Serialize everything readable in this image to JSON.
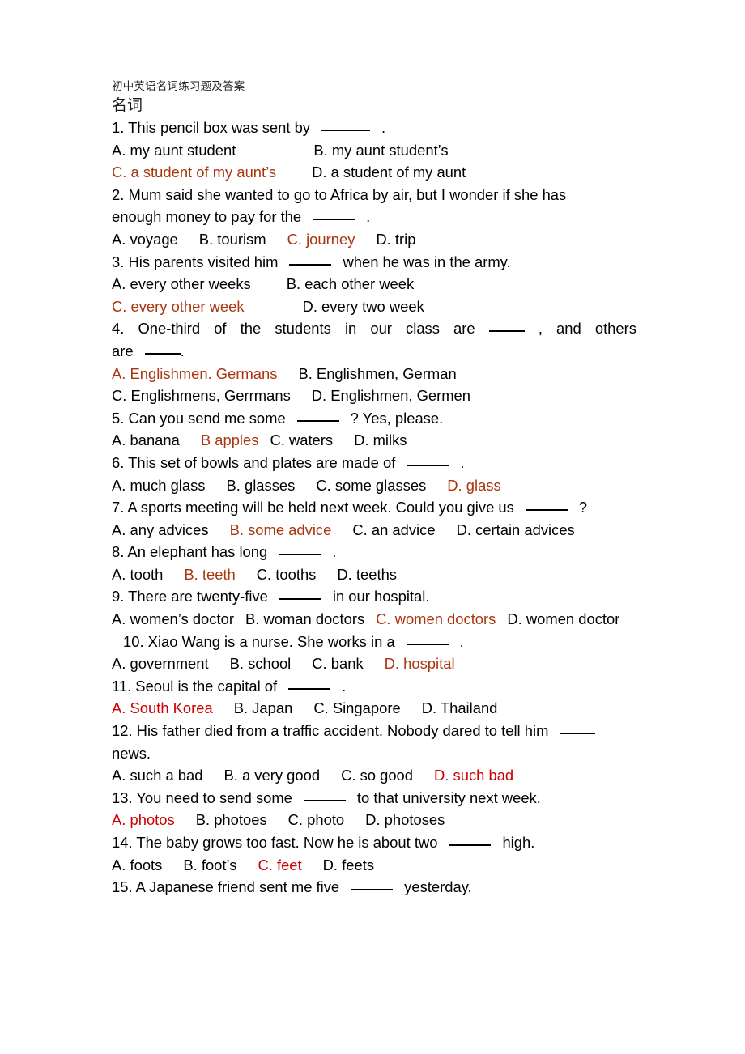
{
  "document": {
    "header_title": "初中英语名词练习题及答案",
    "subtitle": "名词",
    "colors": {
      "answer_brown": "#a8360f",
      "answer_red": "#cc0000",
      "body_text": "#000000",
      "background": "#ffffff"
    }
  },
  "questions": [
    {
      "number": "1",
      "stem_before": "1. This pencil box was sent by",
      "stem_after": ".",
      "options": [
        {
          "label": "A. my aunt student",
          "highlight": "none"
        },
        {
          "label": "B. my aunt student’s",
          "highlight": "none"
        },
        {
          "label": "C. a student of my aunt’s",
          "highlight": "brown"
        },
        {
          "label": "D. a student of my aunt",
          "highlight": "none"
        }
      ]
    },
    {
      "number": "2",
      "stem_line1": "2. Mum said she wanted to go to Africa by air, but    I wonder if she has",
      "stem_line2_before": "enough money to pay for the",
      "stem_line2_after": ".",
      "options": [
        {
          "label": "A. voyage",
          "highlight": "none"
        },
        {
          "label": "B. tourism",
          "highlight": "none"
        },
        {
          "label": "C. journey",
          "highlight": "brown"
        },
        {
          "label": "D. trip",
          "highlight": "none"
        }
      ]
    },
    {
      "number": "3",
      "stem_before": "3. His parents visited him",
      "stem_after": "when he was in the army.",
      "options": [
        {
          "label": "A. every other weeks",
          "highlight": "none"
        },
        {
          "label": "B. each other week",
          "highlight": "none"
        },
        {
          "label": "C. every other week",
          "highlight": "brown"
        },
        {
          "label": "D. every two week",
          "highlight": "none"
        }
      ]
    },
    {
      "number": "4",
      "stem_line1_before": "4. One-third of the students in our class are",
      "stem_line1_after": ", and others",
      "stem_line2_before": "are",
      "stem_line2_after": ".",
      "options": [
        {
          "label": "A. Englishmen. Germans",
          "highlight": "brown"
        },
        {
          "label": "B. Englishmen, German",
          "highlight": "none"
        },
        {
          "label": "C. Englishmens, Gerrmans",
          "highlight": "none"
        },
        {
          "label": "D. Englishmen, Germen",
          "highlight": "none"
        }
      ]
    },
    {
      "number": "5",
      "stem_before": "5. Can you send me some",
      "stem_after": "? Yes, please.",
      "options": [
        {
          "label": "A. banana",
          "highlight": "none"
        },
        {
          "label": "B apples",
          "highlight": "brown"
        },
        {
          "label": "C. waters",
          "highlight": "none"
        },
        {
          "label": "D. milks",
          "highlight": "none"
        }
      ]
    },
    {
      "number": "6",
      "stem_before": "6. This set of bowls and plates are made of",
      "stem_after": ".",
      "options": [
        {
          "label": "A. much glass",
          "highlight": "none"
        },
        {
          "label": "B. glasses",
          "highlight": "none"
        },
        {
          "label": "C. some glasses",
          "highlight": "none"
        },
        {
          "label": "D. glass",
          "highlight": "brown"
        }
      ]
    },
    {
      "number": "7",
      "stem_before": "7. A sports meeting will be held next week. Could you give us",
      "stem_after": "?",
      "options": [
        {
          "label": "A. any advices",
          "highlight": "none"
        },
        {
          "label": "B. some advice",
          "highlight": "brown"
        },
        {
          "label": "C. an advice",
          "highlight": "none"
        },
        {
          "label": "D. certain advices",
          "highlight": "none"
        }
      ]
    },
    {
      "number": "8",
      "stem_before": "8. An elephant has long",
      "stem_after": ".",
      "options": [
        {
          "label": "A. tooth",
          "highlight": "none"
        },
        {
          "label": "B. teeth",
          "highlight": "brown"
        },
        {
          "label": "C. tooths",
          "highlight": "none"
        },
        {
          "label": "D. teeths",
          "highlight": "none"
        }
      ]
    },
    {
      "number": "9",
      "stem_before": "9. There are twenty-five",
      "stem_after": "in our hospital.",
      "options": [
        {
          "label": "A. women’s doctor",
          "highlight": "none"
        },
        {
          "label": "B. woman doctors",
          "highlight": "none"
        },
        {
          "label": "C. women doctors",
          "highlight": "brown"
        },
        {
          "label": "D. women doctor",
          "highlight": "none"
        }
      ]
    },
    {
      "number": "10",
      "stem_before": "10. Xiao Wang is a nurse. She works in a",
      "stem_after": ".",
      "options": [
        {
          "label": "A. government",
          "highlight": "none"
        },
        {
          "label": "B. school",
          "highlight": "none"
        },
        {
          "label": "C. bank",
          "highlight": "none"
        },
        {
          "label": "D. hospital",
          "highlight": "brown"
        }
      ]
    },
    {
      "number": "11",
      "stem_before": "11. Seoul is the capital of",
      "stem_after": ".",
      "options": [
        {
          "label": "A. South Korea",
          "highlight": "red"
        },
        {
          "label": "B. Japan",
          "highlight": "none"
        },
        {
          "label": "C. Singapore",
          "highlight": "none"
        },
        {
          "label": "D. Thailand",
          "highlight": "none"
        }
      ]
    },
    {
      "number": "12",
      "stem_line1": "12. His father died from a traffic accident. Nobody dared to tell him",
      "stem_line2": "news.",
      "options": [
        {
          "label": "A. such a bad",
          "highlight": "none"
        },
        {
          "label": "B. a very good",
          "highlight": "none"
        },
        {
          "label": "C. so good",
          "highlight": "none"
        },
        {
          "label": "D. such bad",
          "highlight": "red"
        }
      ]
    },
    {
      "number": "13",
      "stem_before": "13. You need to send some",
      "stem_after": "to that university next week.",
      "options": [
        {
          "label": "A. photos",
          "highlight": "red"
        },
        {
          "label": "B. photoes",
          "highlight": "none"
        },
        {
          "label": "C. photo",
          "highlight": "none"
        },
        {
          "label": "D. photoses",
          "highlight": "none"
        }
      ]
    },
    {
      "number": "14",
      "stem_before": "14. The baby grows too fast. Now he is about two",
      "stem_after": "high.",
      "options": [
        {
          "label": "A. foots",
          "highlight": "none"
        },
        {
          "label": "B. foot’s",
          "highlight": "none"
        },
        {
          "label": "C. feet",
          "highlight": "red"
        },
        {
          "label": "D. feets",
          "highlight": "none"
        }
      ]
    },
    {
      "number": "15",
      "stem_before": "15. A Japanese friend sent me five",
      "stem_after": "yesterday.",
      "options": []
    }
  ]
}
